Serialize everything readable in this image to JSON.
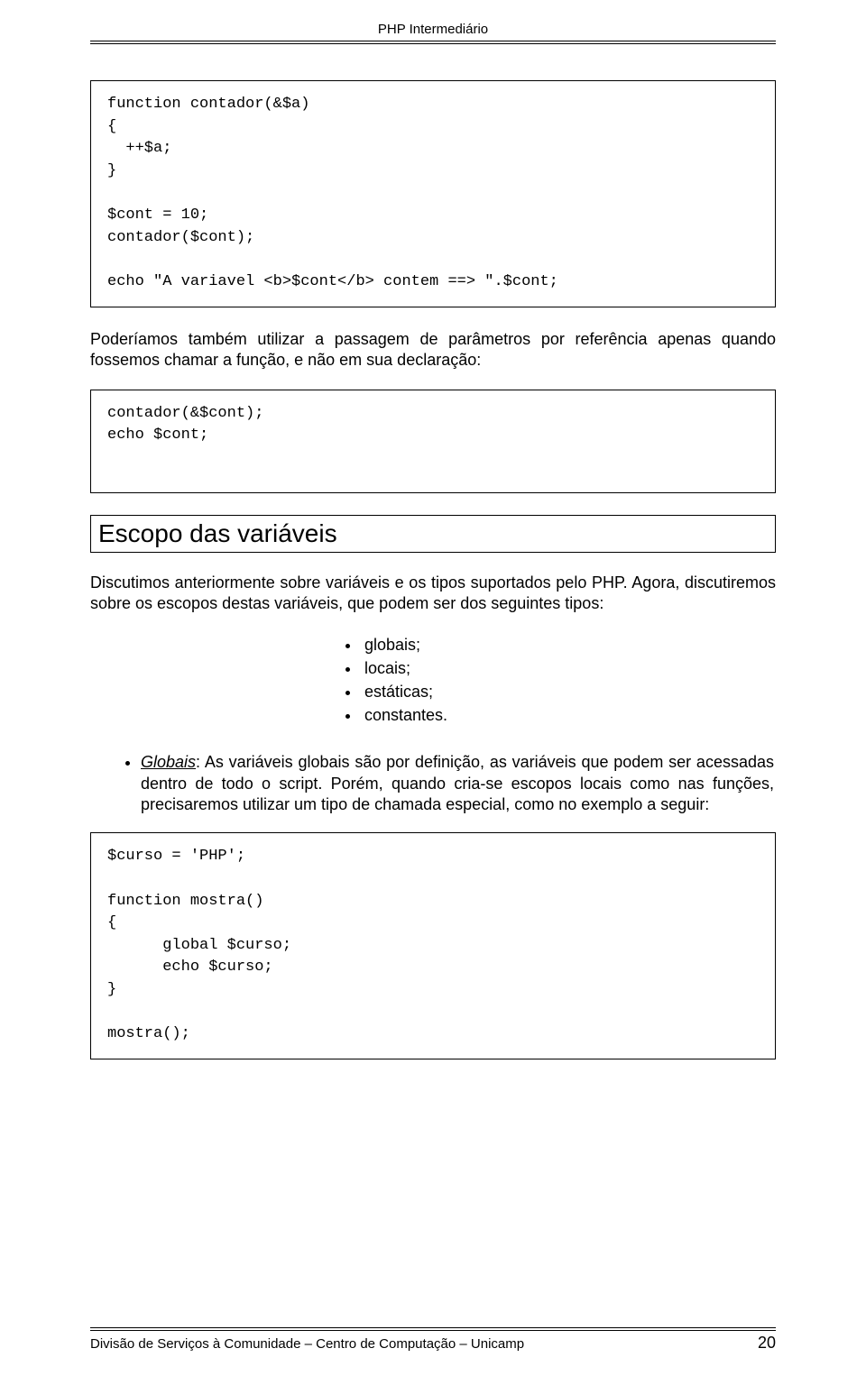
{
  "header": {
    "title": "PHP Intermediário"
  },
  "code1": "function contador(&$a)\n{\n  ++$a;\n}\n\n$cont = 10;\ncontador($cont);\n\necho \"A variavel <b>$cont</b> contem ==> \".$cont;",
  "para1": "Poderíamos também utilizar a passagem de parâmetros por referência apenas quando fossemos chamar a função, e não em sua declaração:",
  "code2": "contador(&$cont);\necho $cont;",
  "section": {
    "title": "Escopo das variáveis"
  },
  "para2": "Discutimos anteriormente sobre variáveis e os tipos suportados pelo PHP. Agora, discutiremos sobre os escopos destas variáveis, que podem ser dos seguintes tipos:",
  "types": [
    "globais;",
    "locais;",
    "estáticas;",
    "constantes."
  ],
  "globais_term": "Globais",
  "globais_text": ": As variáveis globais são por definição, as variáveis que podem ser acessadas dentro de todo o script. Porém, quando cria-se escopos locais como nas funções, precisaremos utilizar um tipo de chamada especial, como no exemplo a seguir:",
  "code3": "$curso = 'PHP';\n\nfunction mostra()\n{\n      global $curso;\n      echo $curso;\n}\n\nmostra();",
  "footer": {
    "text": "Divisão de Serviços à Comunidade  –  Centro de Computação  –  Unicamp",
    "page": "20"
  }
}
